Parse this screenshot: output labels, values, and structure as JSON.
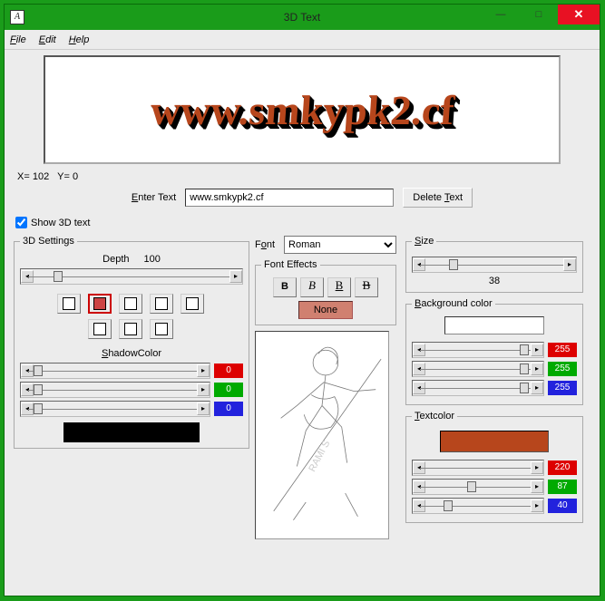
{
  "window": {
    "title": "3D Text",
    "app_icon": "A"
  },
  "winbuttons": {
    "min": "—",
    "max": "□",
    "close": "✕"
  },
  "menu": {
    "file": "File",
    "edit": "Edit",
    "help": "Help"
  },
  "preview_text": "www.smkypk2.cf",
  "coords": {
    "x_label": "X=",
    "x": "102",
    "y_label": "Y=",
    "y": "0"
  },
  "enter": {
    "label": "Enter Text",
    "value": "www.smkypk2.cf",
    "delete": "Delete Text"
  },
  "show3d": {
    "label": "Show 3D text",
    "checked": true
  },
  "font": {
    "label": "Font",
    "value": "Roman"
  },
  "settings3d": {
    "legend": "3D Settings",
    "depth_label": "Depth",
    "depth_value": "100"
  },
  "shadow": {
    "label": "ShadowColor",
    "r": "0",
    "g": "0",
    "b": "0",
    "swatch": "#000000"
  },
  "fonteffects": {
    "legend": "Font Effects",
    "b": "B",
    "i": "B",
    "u": "B",
    "s": "B",
    "none": "None"
  },
  "size": {
    "legend": "Size",
    "value": "38"
  },
  "bgcolor": {
    "legend": "Background color",
    "r": "255",
    "g": "255",
    "b": "255",
    "swatch": "#ffffff"
  },
  "textcolor": {
    "legend": "Textcolor",
    "r": "220",
    "g": "87",
    "b": "40",
    "swatch": "#b7461c"
  }
}
